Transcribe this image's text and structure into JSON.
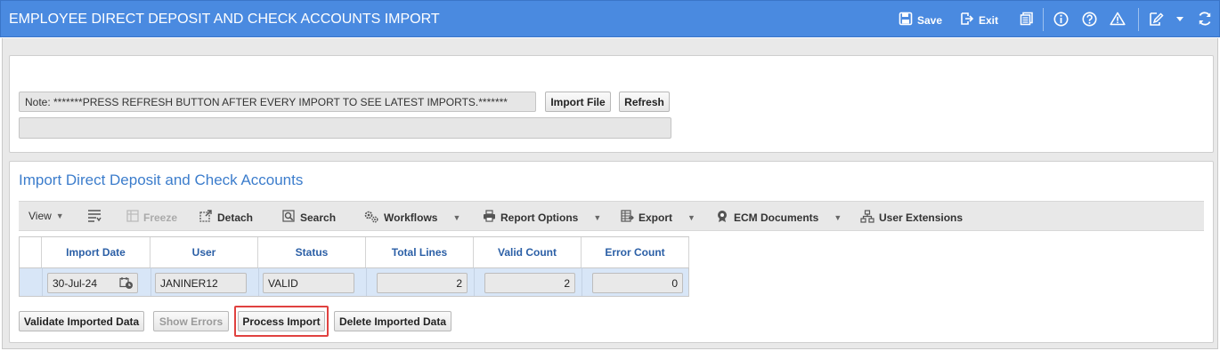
{
  "header": {
    "title": "EMPLOYEE DIRECT DEPOSIT AND CHECK ACCOUNTS IMPORT",
    "save_label": "Save",
    "exit_label": "Exit"
  },
  "import_panel": {
    "note": "Note: *******PRESS REFRESH BUTTON AFTER EVERY IMPORT TO SEE LATEST IMPORTS.*******",
    "import_file_label": "Import File",
    "refresh_label": "Refresh"
  },
  "section": {
    "title": "Import Direct Deposit and Check Accounts"
  },
  "toolbar": {
    "view": "View",
    "freeze": "Freeze",
    "detach": "Detach",
    "search": "Search",
    "workflows": "Workflows",
    "report_options": "Report Options",
    "export": "Export",
    "ecm_documents": "ECM Documents",
    "user_extensions": "User Extensions"
  },
  "grid": {
    "columns": [
      "Import Date",
      "User",
      "Status",
      "Total Lines",
      "Valid Count",
      "Error Count"
    ],
    "rows": [
      {
        "import_date": "30-Jul-24",
        "user": "JANINER12",
        "status": "VALID",
        "total_lines": "2",
        "valid_count": "2",
        "error_count": "0"
      }
    ]
  },
  "actions": {
    "validate": "Validate Imported Data",
    "show_errors": "Show Errors",
    "process": "Process Import",
    "delete": "Delete Imported Data"
  },
  "colors": {
    "header_bg": "#4a8ae0",
    "accent_text": "#3c7dcc",
    "highlight_border": "#e0413f",
    "selected_row": "#d8e6f7"
  }
}
